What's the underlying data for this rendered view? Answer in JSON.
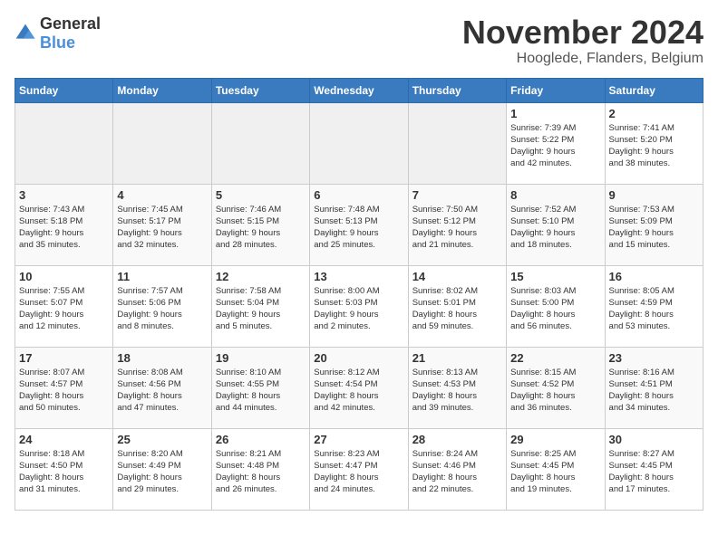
{
  "logo": {
    "general": "General",
    "blue": "Blue"
  },
  "header": {
    "month": "November 2024",
    "location": "Hooglede, Flanders, Belgium"
  },
  "days_of_week": [
    "Sunday",
    "Monday",
    "Tuesday",
    "Wednesday",
    "Thursday",
    "Friday",
    "Saturday"
  ],
  "weeks": [
    [
      {
        "day": "",
        "info": ""
      },
      {
        "day": "",
        "info": ""
      },
      {
        "day": "",
        "info": ""
      },
      {
        "day": "",
        "info": ""
      },
      {
        "day": "",
        "info": ""
      },
      {
        "day": "1",
        "info": "Sunrise: 7:39 AM\nSunset: 5:22 PM\nDaylight: 9 hours\nand 42 minutes."
      },
      {
        "day": "2",
        "info": "Sunrise: 7:41 AM\nSunset: 5:20 PM\nDaylight: 9 hours\nand 38 minutes."
      }
    ],
    [
      {
        "day": "3",
        "info": "Sunrise: 7:43 AM\nSunset: 5:18 PM\nDaylight: 9 hours\nand 35 minutes."
      },
      {
        "day": "4",
        "info": "Sunrise: 7:45 AM\nSunset: 5:17 PM\nDaylight: 9 hours\nand 32 minutes."
      },
      {
        "day": "5",
        "info": "Sunrise: 7:46 AM\nSunset: 5:15 PM\nDaylight: 9 hours\nand 28 minutes."
      },
      {
        "day": "6",
        "info": "Sunrise: 7:48 AM\nSunset: 5:13 PM\nDaylight: 9 hours\nand 25 minutes."
      },
      {
        "day": "7",
        "info": "Sunrise: 7:50 AM\nSunset: 5:12 PM\nDaylight: 9 hours\nand 21 minutes."
      },
      {
        "day": "8",
        "info": "Sunrise: 7:52 AM\nSunset: 5:10 PM\nDaylight: 9 hours\nand 18 minutes."
      },
      {
        "day": "9",
        "info": "Sunrise: 7:53 AM\nSunset: 5:09 PM\nDaylight: 9 hours\nand 15 minutes."
      }
    ],
    [
      {
        "day": "10",
        "info": "Sunrise: 7:55 AM\nSunset: 5:07 PM\nDaylight: 9 hours\nand 12 minutes."
      },
      {
        "day": "11",
        "info": "Sunrise: 7:57 AM\nSunset: 5:06 PM\nDaylight: 9 hours\nand 8 minutes."
      },
      {
        "day": "12",
        "info": "Sunrise: 7:58 AM\nSunset: 5:04 PM\nDaylight: 9 hours\nand 5 minutes."
      },
      {
        "day": "13",
        "info": "Sunrise: 8:00 AM\nSunset: 5:03 PM\nDaylight: 9 hours\nand 2 minutes."
      },
      {
        "day": "14",
        "info": "Sunrise: 8:02 AM\nSunset: 5:01 PM\nDaylight: 8 hours\nand 59 minutes."
      },
      {
        "day": "15",
        "info": "Sunrise: 8:03 AM\nSunset: 5:00 PM\nDaylight: 8 hours\nand 56 minutes."
      },
      {
        "day": "16",
        "info": "Sunrise: 8:05 AM\nSunset: 4:59 PM\nDaylight: 8 hours\nand 53 minutes."
      }
    ],
    [
      {
        "day": "17",
        "info": "Sunrise: 8:07 AM\nSunset: 4:57 PM\nDaylight: 8 hours\nand 50 minutes."
      },
      {
        "day": "18",
        "info": "Sunrise: 8:08 AM\nSunset: 4:56 PM\nDaylight: 8 hours\nand 47 minutes."
      },
      {
        "day": "19",
        "info": "Sunrise: 8:10 AM\nSunset: 4:55 PM\nDaylight: 8 hours\nand 44 minutes."
      },
      {
        "day": "20",
        "info": "Sunrise: 8:12 AM\nSunset: 4:54 PM\nDaylight: 8 hours\nand 42 minutes."
      },
      {
        "day": "21",
        "info": "Sunrise: 8:13 AM\nSunset: 4:53 PM\nDaylight: 8 hours\nand 39 minutes."
      },
      {
        "day": "22",
        "info": "Sunrise: 8:15 AM\nSunset: 4:52 PM\nDaylight: 8 hours\nand 36 minutes."
      },
      {
        "day": "23",
        "info": "Sunrise: 8:16 AM\nSunset: 4:51 PM\nDaylight: 8 hours\nand 34 minutes."
      }
    ],
    [
      {
        "day": "24",
        "info": "Sunrise: 8:18 AM\nSunset: 4:50 PM\nDaylight: 8 hours\nand 31 minutes."
      },
      {
        "day": "25",
        "info": "Sunrise: 8:20 AM\nSunset: 4:49 PM\nDaylight: 8 hours\nand 29 minutes."
      },
      {
        "day": "26",
        "info": "Sunrise: 8:21 AM\nSunset: 4:48 PM\nDaylight: 8 hours\nand 26 minutes."
      },
      {
        "day": "27",
        "info": "Sunrise: 8:23 AM\nSunset: 4:47 PM\nDaylight: 8 hours\nand 24 minutes."
      },
      {
        "day": "28",
        "info": "Sunrise: 8:24 AM\nSunset: 4:46 PM\nDaylight: 8 hours\nand 22 minutes."
      },
      {
        "day": "29",
        "info": "Sunrise: 8:25 AM\nSunset: 4:45 PM\nDaylight: 8 hours\nand 19 minutes."
      },
      {
        "day": "30",
        "info": "Sunrise: 8:27 AM\nSunset: 4:45 PM\nDaylight: 8 hours\nand 17 minutes."
      }
    ]
  ]
}
